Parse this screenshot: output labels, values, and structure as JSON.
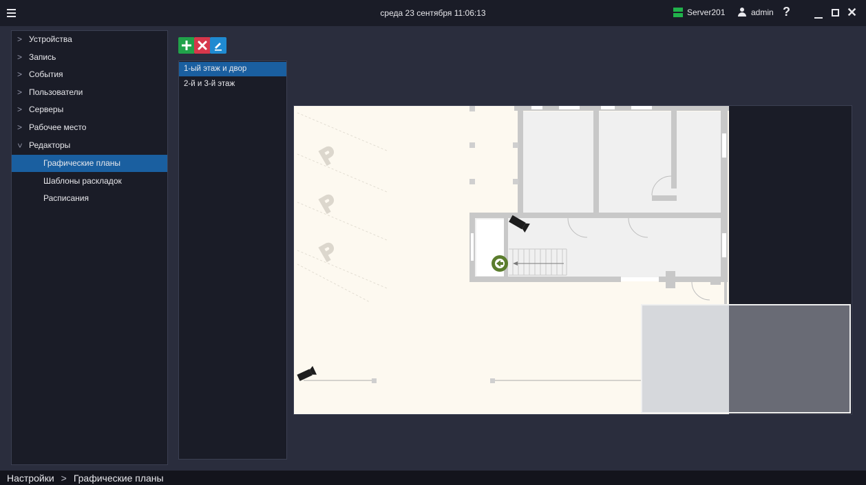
{
  "header": {
    "datetime": "среда 23 сентября 11:06:13",
    "server_name": "Server201",
    "user_name": "admin",
    "help_label": "?",
    "close_label": "✕"
  },
  "sidebar": {
    "items": [
      {
        "label": "Устройства",
        "expanded": false
      },
      {
        "label": "Запись",
        "expanded": false
      },
      {
        "label": "События",
        "expanded": false
      },
      {
        "label": "Пользователи",
        "expanded": false
      },
      {
        "label": "Серверы",
        "expanded": false
      },
      {
        "label": "Рабочее место",
        "expanded": false
      },
      {
        "label": "Редакторы",
        "expanded": true
      }
    ],
    "sub_items": [
      {
        "label": "Графические планы",
        "selected": true
      },
      {
        "label": "Шаблоны раскладок",
        "selected": false
      },
      {
        "label": "Расписания",
        "selected": false
      }
    ]
  },
  "toolbar": {
    "add": "plus-icon",
    "delete": "close-icon",
    "edit": "pencil-icon"
  },
  "plans": [
    {
      "label": "1-ый этаж и двор",
      "selected": true
    },
    {
      "label": "2-й и 3-й этаж",
      "selected": false
    }
  ],
  "map": {
    "floor_color": "#fdf9f0",
    "wall_color": "#c8c8c8",
    "parking_marks": [
      "P",
      "P",
      "P"
    ],
    "camera_count": 2
  },
  "status": {
    "crumb_root": "Настройки",
    "crumb_sep": ">",
    "crumb_current": "Графические планы"
  },
  "colors": {
    "accent": "#1a5fa0",
    "add": "#21a24a",
    "delete": "#d7374b",
    "edit": "#1f8ad1",
    "server_status": "#21b24b"
  }
}
